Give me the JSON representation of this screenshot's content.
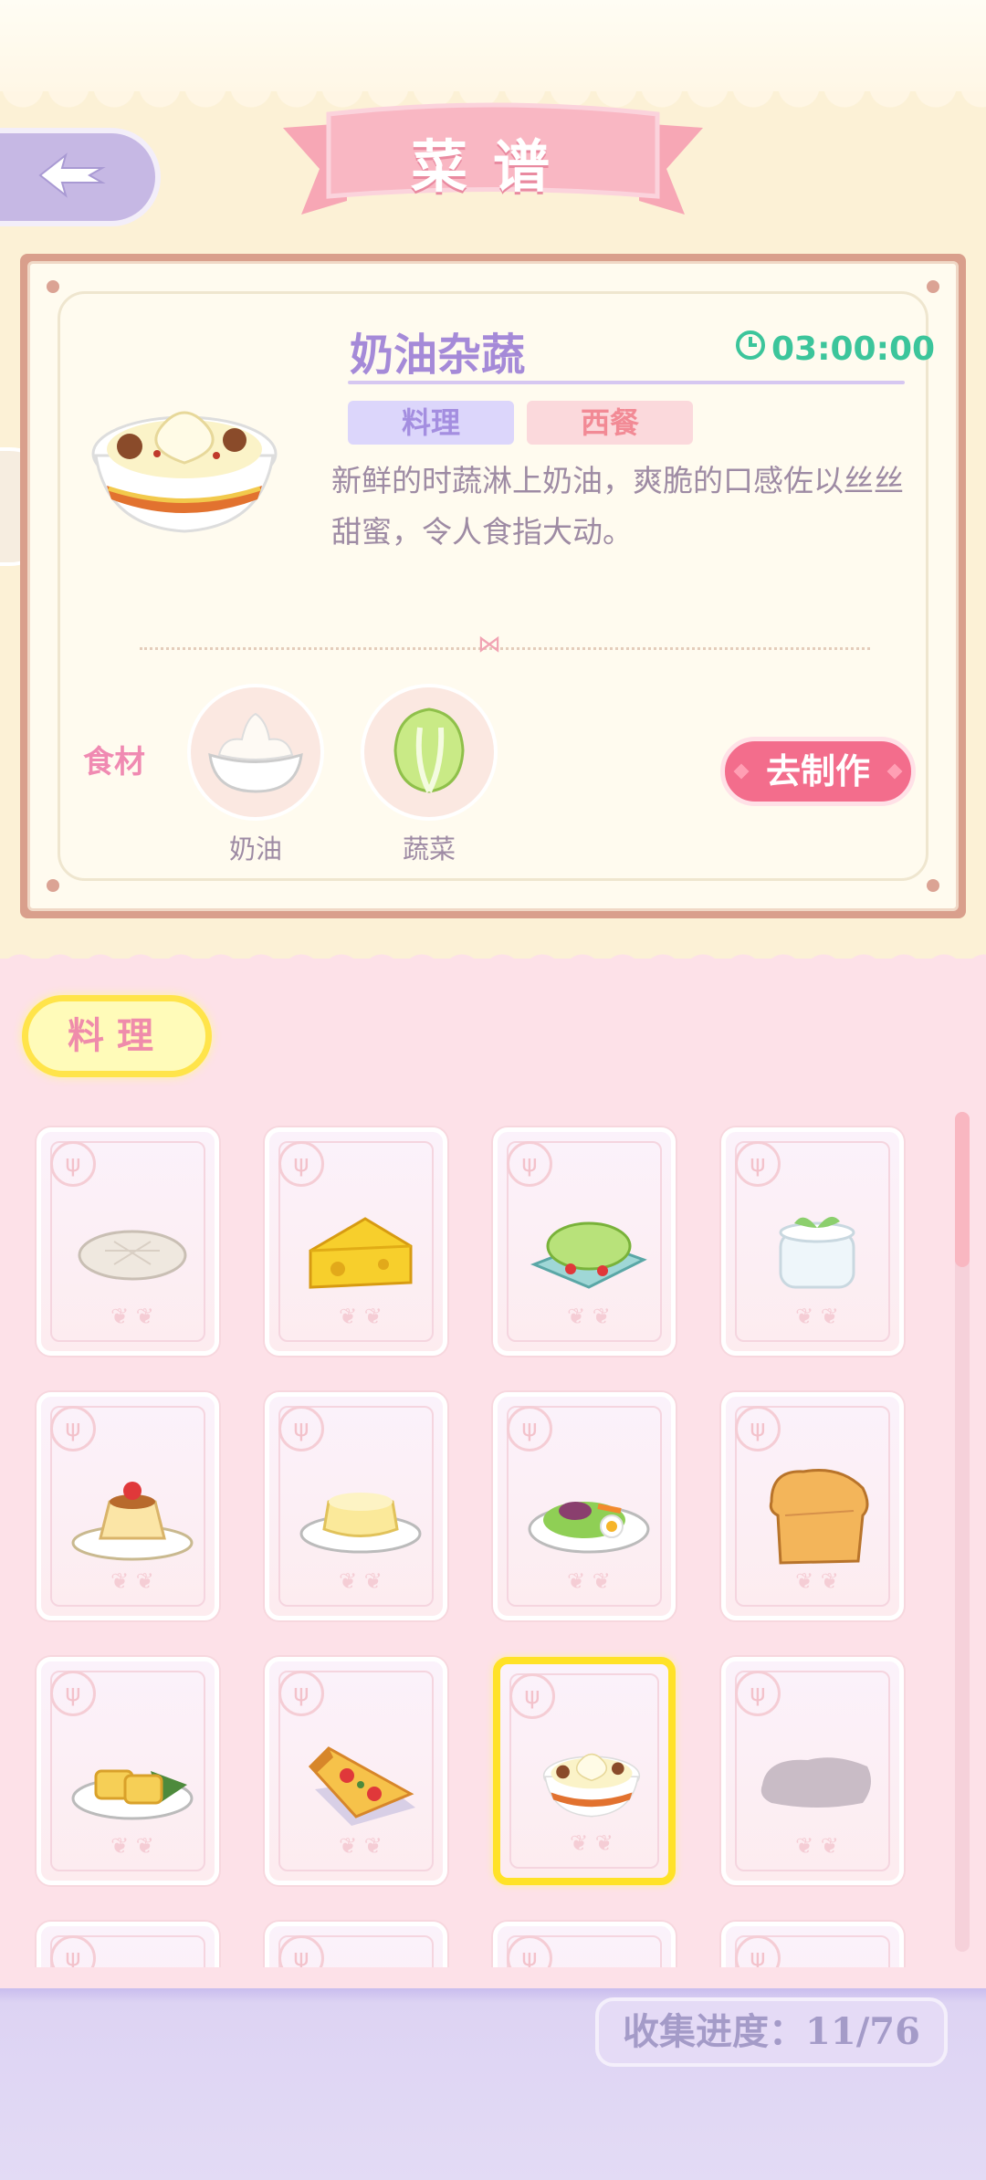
{
  "header": {
    "title": "菜谱"
  },
  "recipe": {
    "name": "奶油杂蔬",
    "time": "03:00:00",
    "tags": [
      "料理",
      "西餐"
    ],
    "description": "新鲜的时蔬淋上奶油，爽脆的口感佐以丝丝甜蜜，令人食指大动。",
    "ingredients_label": "食材",
    "ingredients": [
      {
        "name": "奶油",
        "icon": "cream-icon"
      },
      {
        "name": "蔬菜",
        "icon": "cabbage-icon"
      }
    ],
    "make_button": "去制作"
  },
  "category": {
    "active_tab": "料理"
  },
  "grid": {
    "items": [
      {
        "icon": "flatbread-icon",
        "unlocked": true
      },
      {
        "icon": "cheese-icon",
        "unlocked": true
      },
      {
        "icon": "salad-icon",
        "unlocked": true
      },
      {
        "icon": "yogurt-icon",
        "unlocked": true
      },
      {
        "icon": "pudding-icon",
        "unlocked": true
      },
      {
        "icon": "cheesecake-icon",
        "unlocked": true
      },
      {
        "icon": "egg-salad-icon",
        "unlocked": true
      },
      {
        "icon": "bread-loaf-icon",
        "unlocked": true
      },
      {
        "icon": "egg-roll-icon",
        "unlocked": true
      },
      {
        "icon": "pizza-icon",
        "unlocked": true
      },
      {
        "icon": "cream-vegetables-icon",
        "unlocked": true,
        "selected": true
      },
      {
        "icon": "locked-silhouette-icon",
        "unlocked": false
      }
    ]
  },
  "progress": {
    "label": "收集进度：",
    "value": "11/76"
  },
  "colors": {
    "accent_pink": "#f36d8c",
    "accent_purple": "#a58ad8",
    "timer_green": "#3cc59b",
    "highlight_yellow": "#ffe227"
  }
}
